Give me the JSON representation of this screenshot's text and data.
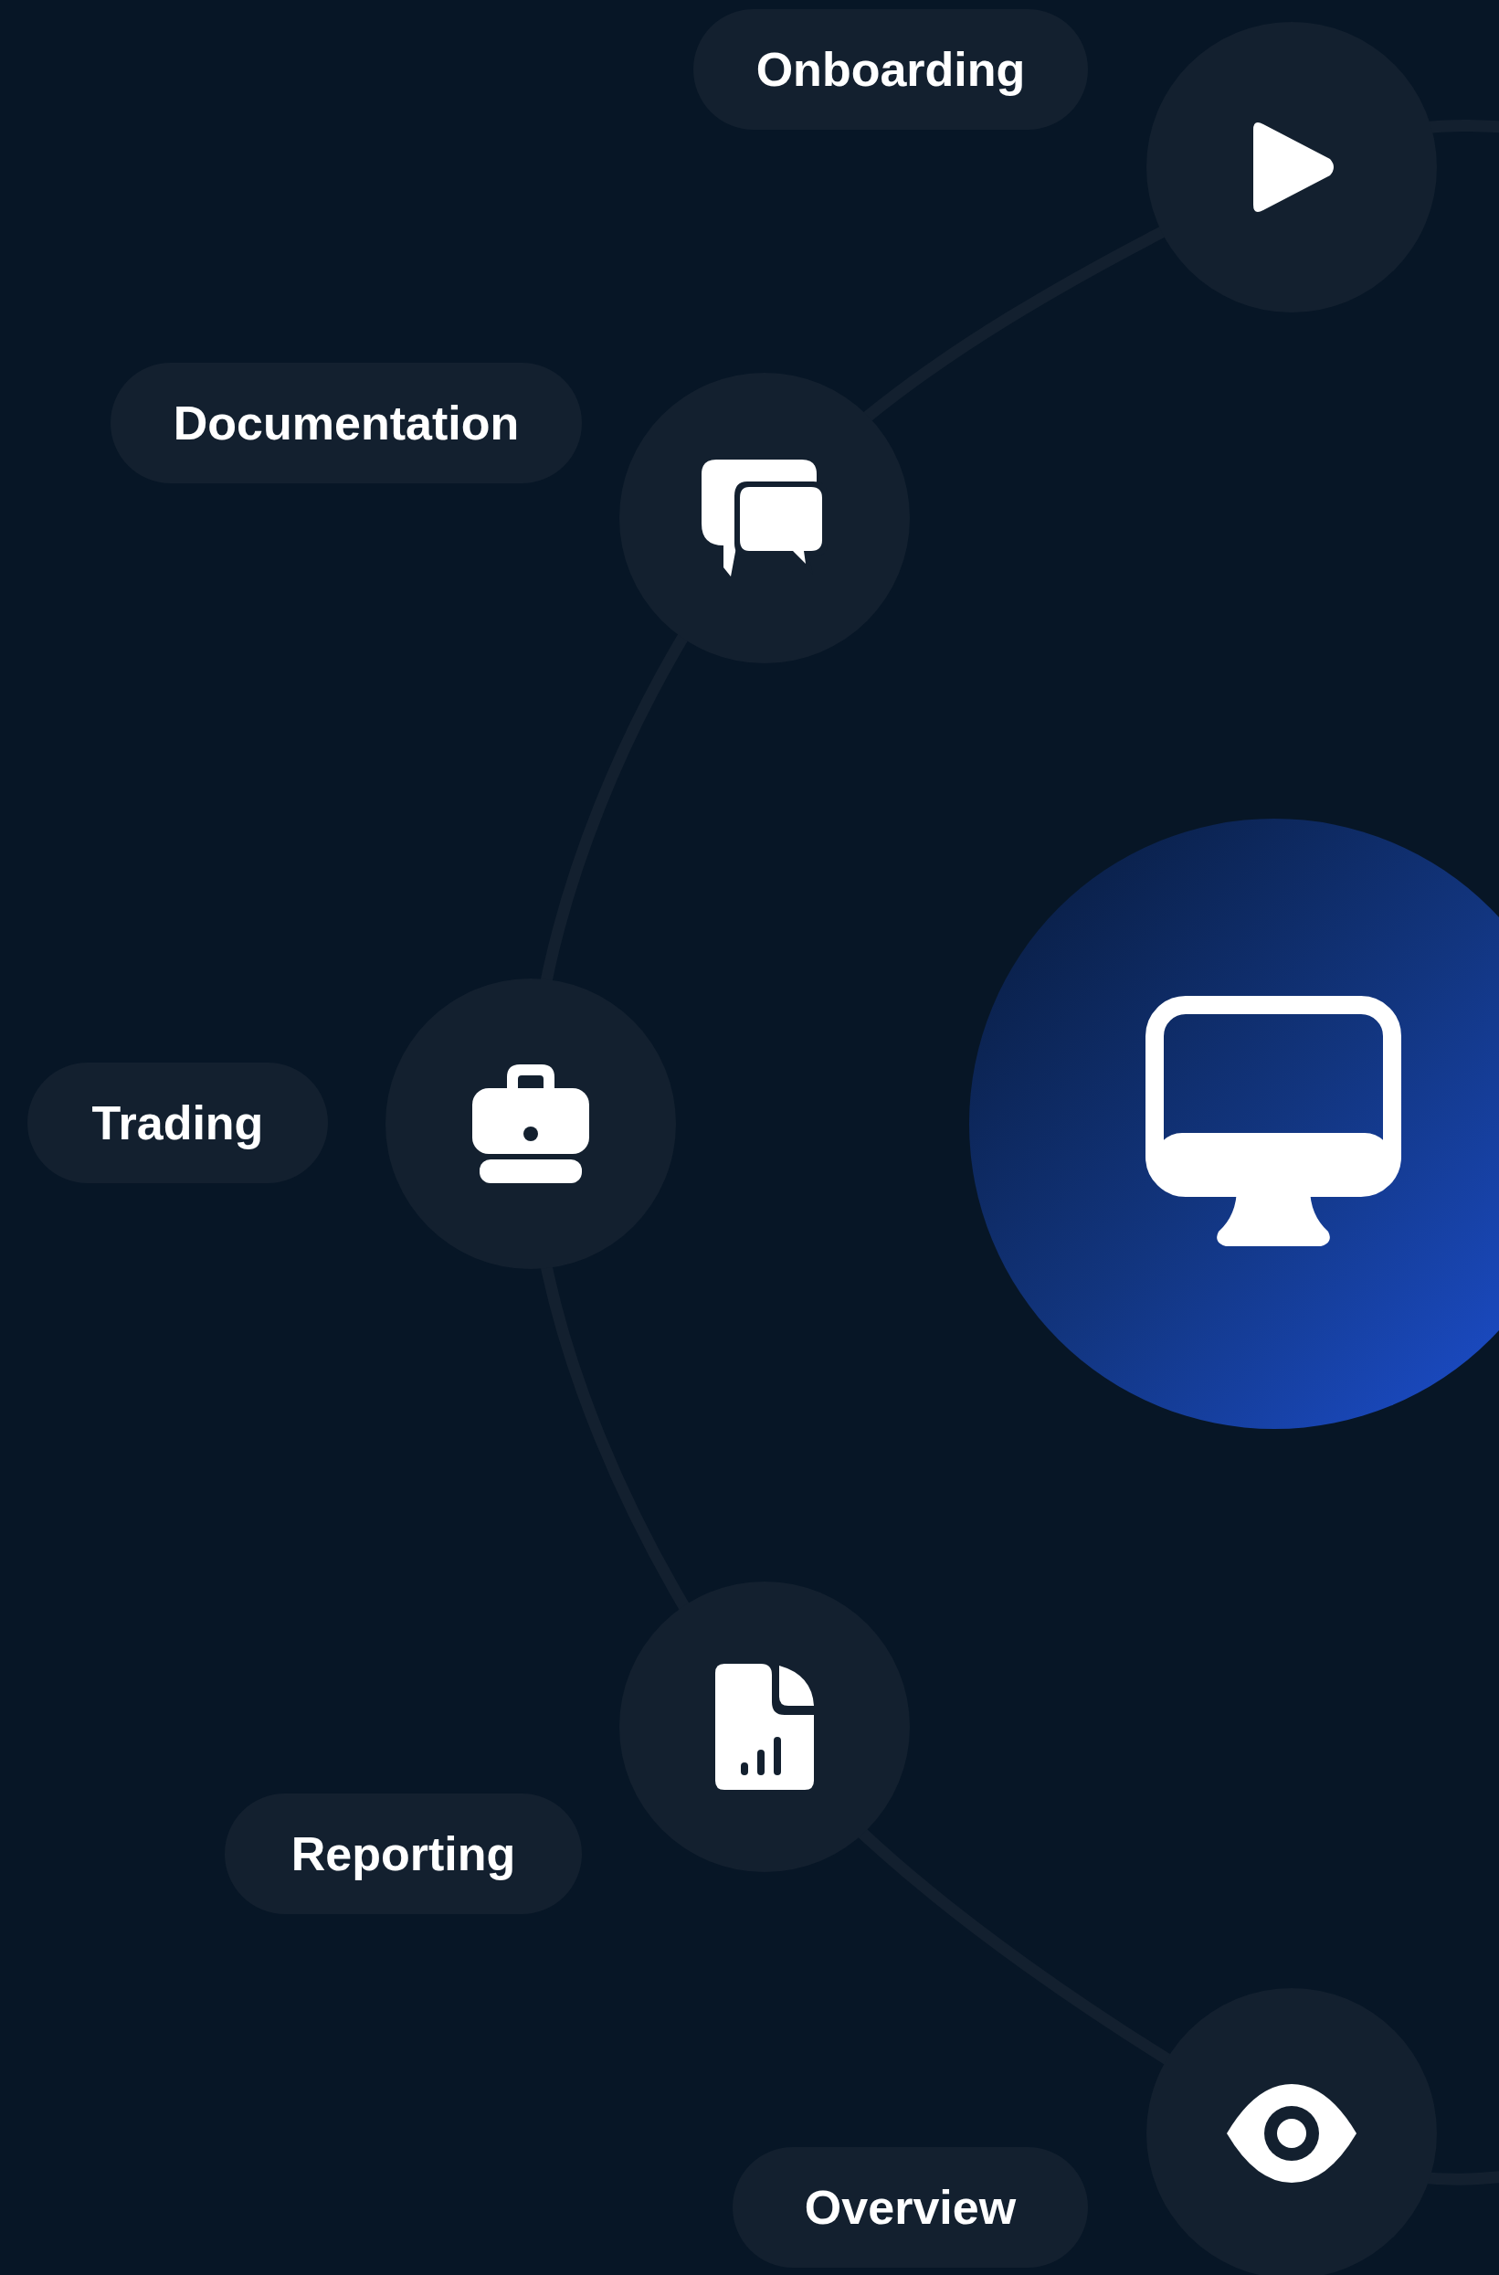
{
  "steps": [
    {
      "label": "Onboarding"
    },
    {
      "label": "Documentation"
    },
    {
      "label": "Trading"
    },
    {
      "label": "Reporting"
    },
    {
      "label": "Overview"
    }
  ]
}
